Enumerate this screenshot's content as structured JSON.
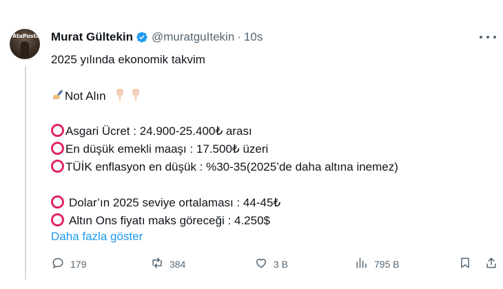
{
  "author": {
    "name": "Murat Gültekin",
    "handle": "@muratguItekin",
    "separator": "·",
    "time": "10s",
    "avatar_text": "AtaPosta"
  },
  "tweet": {
    "line1": "2025 yılında ekonomik takvim",
    "line2": "Not Alın",
    "items": [
      "Asgari Ücret : 24.900-25.400₺ arası",
      "En düşük emekli maaşı : 17.500₺ üzeri",
      "TÜİK enflasyon en düşük : %30-35(2025’de daha altına inemez)",
      "Dolar’ın 2025 seviye ortalaması : 44-45₺",
      "Altın Ons fiyatı maks göreceği : 4.250$"
    ],
    "show_more": "Daha fazla göster"
  },
  "actions": {
    "replies": "179",
    "reposts": "384",
    "likes": "3 B",
    "views": "795 B"
  },
  "colors": {
    "accent": "#1d9bf0",
    "secondary_text": "#536471",
    "bullet_circle": "#e0245e",
    "verified": "#1d9bf0"
  },
  "icons": [
    "verified-badge-icon",
    "more-icon",
    "writing-hand-icon",
    "pointing-down-icon",
    "red-circle-icon",
    "reply-icon",
    "repost-icon",
    "like-icon",
    "views-icon",
    "bookmark-icon",
    "share-icon"
  ]
}
